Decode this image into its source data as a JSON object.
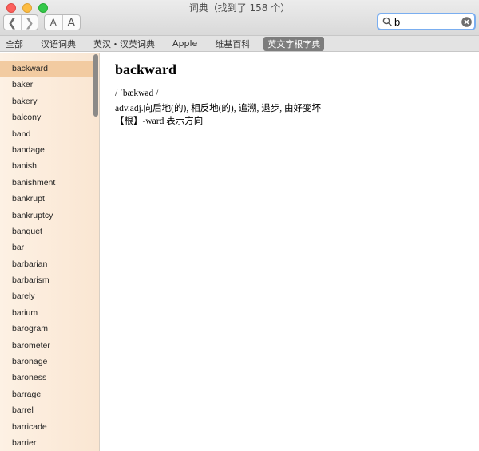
{
  "window": {
    "title": "词典（找到了 158 个）"
  },
  "toolbar": {
    "back_glyph": "❮",
    "forward_glyph": "❯",
    "font_smaller_label": "A",
    "font_larger_label": "A"
  },
  "search": {
    "value": "b"
  },
  "tabs": [
    {
      "label": "全部",
      "active": false
    },
    {
      "label": "汉语词典",
      "active": false
    },
    {
      "label": "英汉・汉英词典",
      "active": false
    },
    {
      "label": "Apple",
      "active": false
    },
    {
      "label": "维基百科",
      "active": false
    },
    {
      "label": "英文字根字典",
      "active": true
    }
  ],
  "sidebar": {
    "items": [
      "backward",
      "baker",
      "bakery",
      "balcony",
      "band",
      "bandage",
      "banish",
      "banishment",
      "bankrupt",
      "bankruptcy",
      "banquet",
      "bar",
      "barbarian",
      "barbarism",
      "barely",
      "barium",
      "barogram",
      "barometer",
      "baronage",
      "baroness",
      "barrage",
      "barrel",
      "barricade",
      "barrier"
    ],
    "selected": "backward"
  },
  "entry": {
    "headword": "backward",
    "pronunciation": "/ ˈbækwəd /",
    "definition": "adv.adj.向后地(的), 相反地(的), 追溯, 退步, 由好变坏",
    "root": "【根】-ward 表示方向"
  }
}
